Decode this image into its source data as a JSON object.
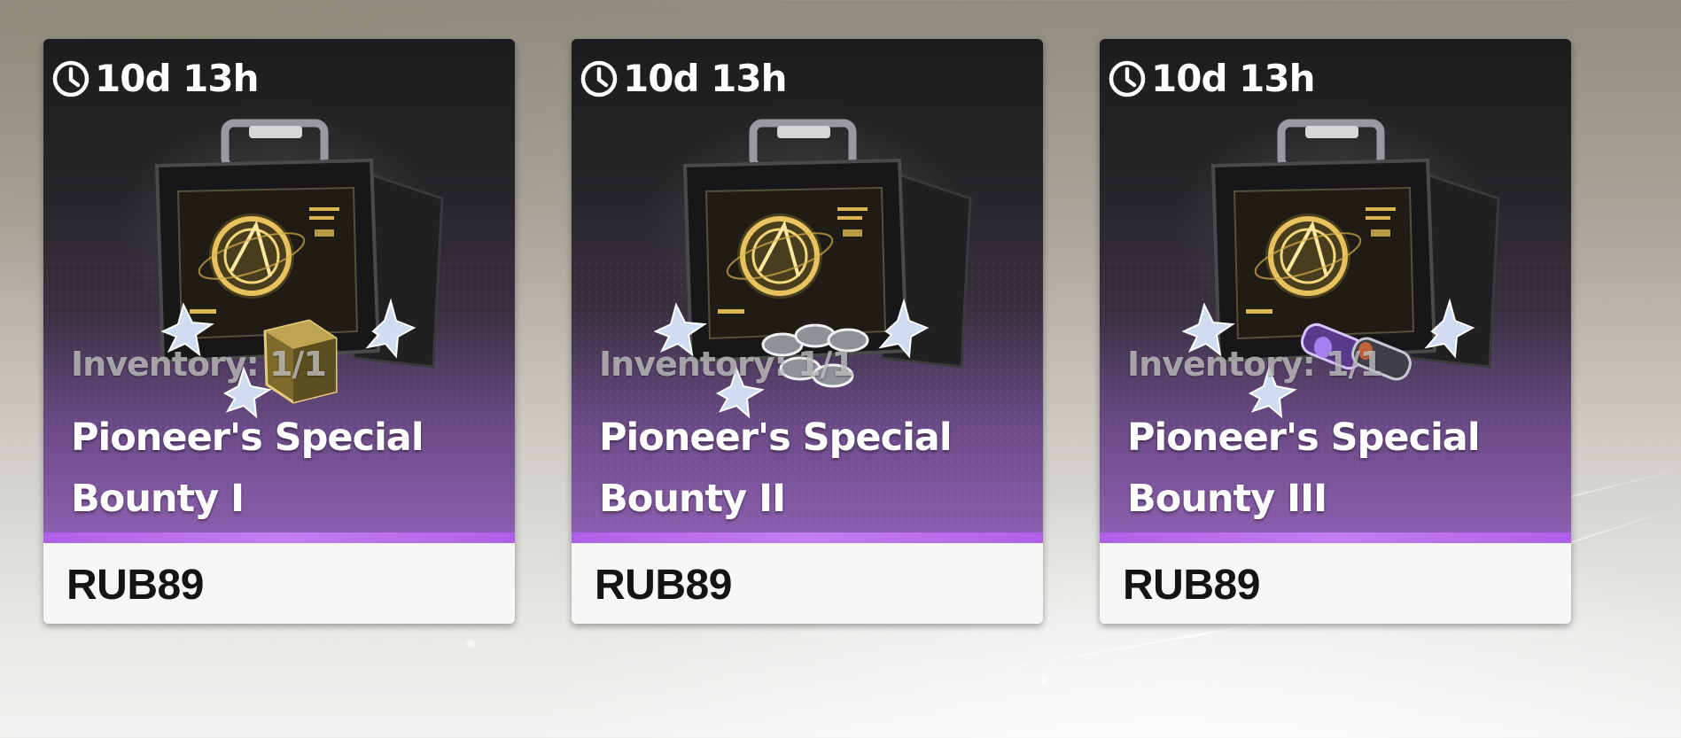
{
  "shop": {
    "cards": [
      {
        "timer": "10d 13h",
        "inventory": "Inventory: 1/1",
        "title_line1": "Pioneer's Special",
        "title_line2": "Bounty I",
        "price": "RUB89",
        "bonus_item": "gold-cube"
      },
      {
        "timer": "10d 13h",
        "inventory": "Inventory: 1/1",
        "title_line1": "Pioneer's Special",
        "title_line2": "Bounty II",
        "price": "RUB89",
        "bonus_item": "silver-coins"
      },
      {
        "timer": "10d 13h",
        "inventory": "Inventory: 1/1",
        "title_line1": "Pioneer's Special",
        "title_line2": "Bounty III",
        "price": "RUB89",
        "bonus_item": "purple-capsules"
      }
    ]
  },
  "colors": {
    "accent_purple": "#c57cf3",
    "price_bar": "#f7f7f7",
    "card_dark": "#1c1c1e"
  }
}
